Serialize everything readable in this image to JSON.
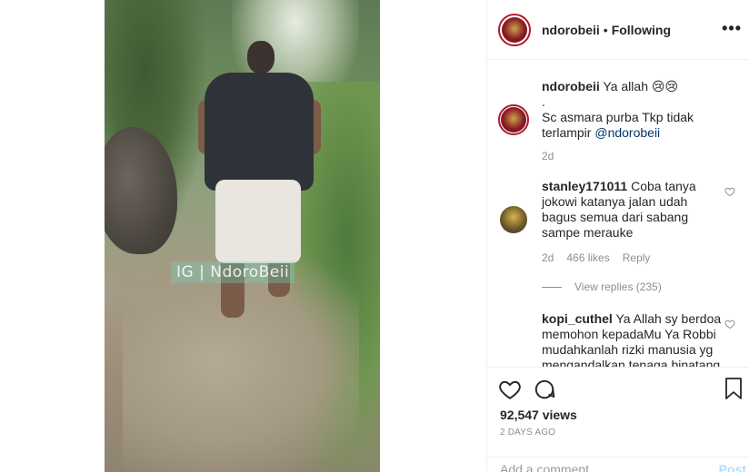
{
  "media": {
    "watermark": "IG | NdoroBeii"
  },
  "header": {
    "username": "ndorobeii",
    "separator": "•",
    "follow_status": "Following",
    "more_icon": "more-dots-icon"
  },
  "caption": {
    "username": "ndorobeii",
    "line1": "Ya allah 😢😢",
    "line2": ".",
    "line3": "Sc asmara purba Tkp tidak terlampir",
    "mention": "@ndorobeii",
    "time": "2d"
  },
  "comments": [
    {
      "username": "stanley171011",
      "text": "Coba tanya jokowi katanya jalan udah bagus semua dari sabang sampe merauke",
      "time": "2d",
      "likes": "466 likes",
      "reply": "Reply",
      "view_replies": "View replies (235)"
    },
    {
      "username": "kopi_cuthel",
      "text": "Ya Allah sy berdoa memohon kepadaMu Ya Robbi mudahkanlah rizki manusia yg mengandalkan tenaga binatang"
    }
  ],
  "actions": {
    "like_icon": "heart-icon",
    "comment_icon": "comment-bubble-icon",
    "bookmark_icon": "bookmark-icon",
    "views": "92,547 views",
    "date": "2 DAYS AGO",
    "add_comment_placeholder": "Add a comment…",
    "post_label": "Post"
  },
  "colors": {
    "text": "#262626",
    "muted": "#8e8e8e",
    "mention": "#003569",
    "post_disabled": "#b2dffc",
    "border": "#efefef"
  }
}
